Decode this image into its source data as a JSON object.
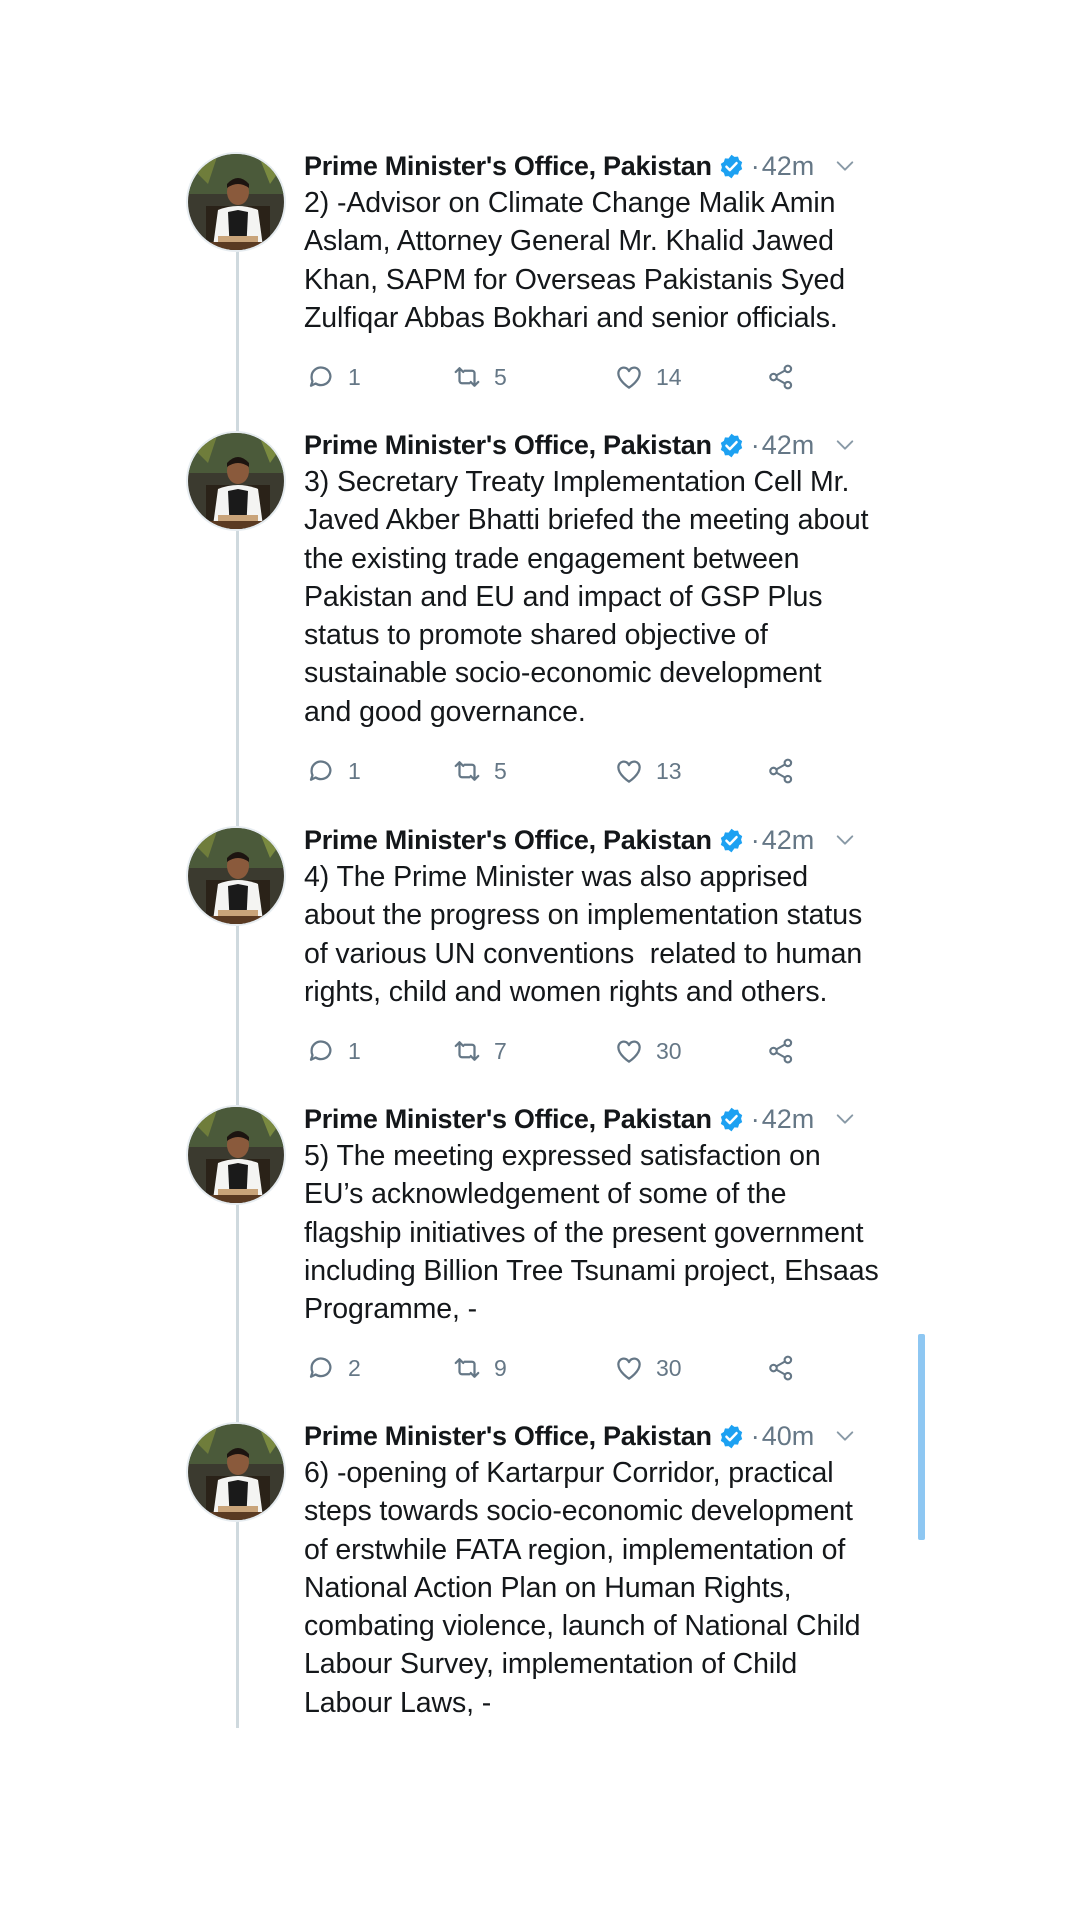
{
  "tweets": [
    {
      "name": "Prime Minister's Office, Pakistan",
      "separator": "·",
      "time": "42m",
      "text": "2) -Advisor on Climate Change Malik Amin\nAslam, Attorney General Mr. Khalid Jawed\nKhan, SAPM for Overseas Pakistanis Syed\nZulfiqar Abbas Bokhari and senior officials.",
      "replies": "1",
      "retweets": "5",
      "likes": "14"
    },
    {
      "name": "Prime Minister's Office, Pakistan",
      "separator": "·",
      "time": "42m",
      "text": "3) Secretary Treaty Implementation Cell Mr.\nJaved Akber Bhatti briefed the meeting about\nthe existing trade engagement between\nPakistan and EU and impact of GSP Plus\nstatus to promote shared objective of\nsustainable socio-economic development\nand good governance.",
      "replies": "1",
      "retweets": "5",
      "likes": "13"
    },
    {
      "name": "Prime Minister's Office, Pakistan",
      "separator": "·",
      "time": "42m",
      "text": "4) The Prime Minister was also apprised\nabout the progress on implementation status\nof various UN conventions  related to human\nrights, child and women rights and others.",
      "replies": "1",
      "retweets": "7",
      "likes": "30"
    },
    {
      "name": "Prime Minister's Office, Pakistan",
      "separator": "·",
      "time": "42m",
      "text": "5) The meeting expressed satisfaction on\nEU’s acknowledgement of some of the\nflagship initiatives of the present government\nincluding Billion Tree Tsunami project, Ehsaas\nProgramme, -",
      "replies": "2",
      "retweets": "9",
      "likes": "30"
    },
    {
      "name": "Prime Minister's Office, Pakistan",
      "separator": "·",
      "time": "40m",
      "text": "6) -opening of Kartarpur Corridor, practical\nsteps towards socio-economic development\nof erstwhile FATA region, implementation of\nNational Action Plan on Human Rights,\ncombating violence, launch of National Child\nLabour Survey, implementation of Child\nLabour Laws, -"
    }
  ],
  "colors": {
    "verified": "#1da1f2",
    "meta": "#657786",
    "thread_line": "#cfd9de",
    "scrollbar": "#8ec7f2"
  },
  "icons": [
    "verified-badge-icon",
    "chevron-down-icon",
    "reply-icon",
    "retweet-icon",
    "like-icon",
    "share-icon"
  ]
}
